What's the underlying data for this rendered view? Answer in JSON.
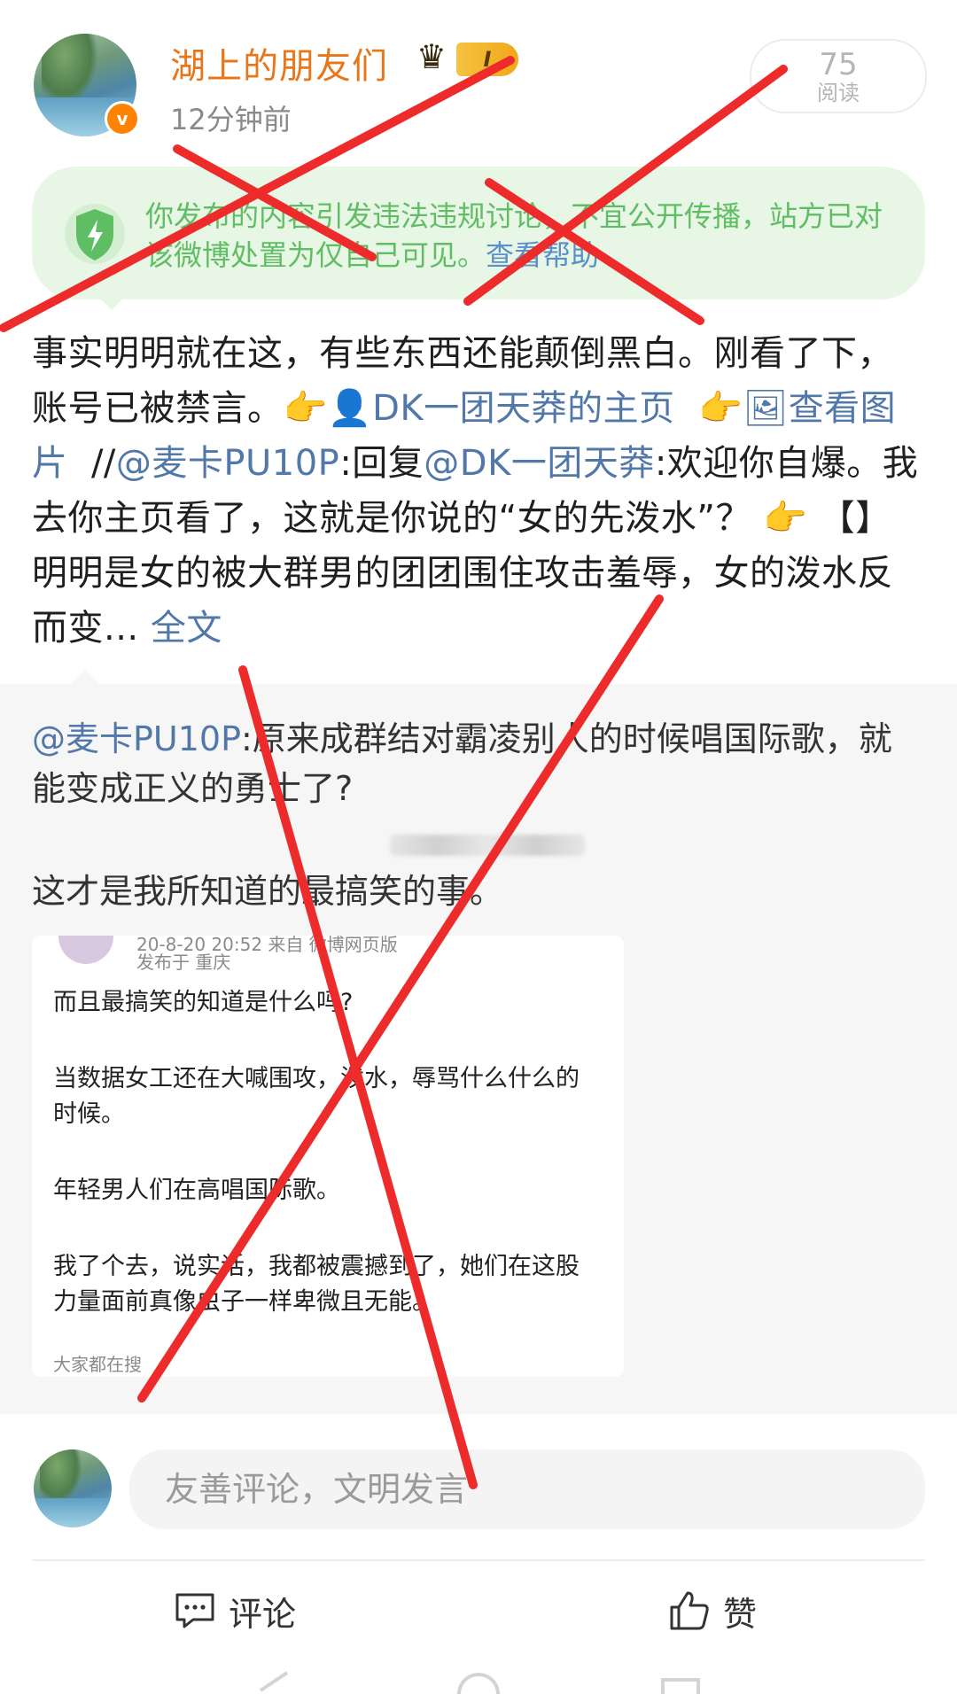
{
  "header": {
    "username": "湖上的朋友们",
    "level_badge": "I",
    "timestamp": "12分钟前",
    "read_count": "75",
    "read_label": "阅读"
  },
  "notice": {
    "text": "你发布的内容引发违法违规讨论，不宜公开传播，站方已对该微博处置为仅自己可见。",
    "help_link": "查看帮助"
  },
  "post": {
    "seg1": "事实明明就在这，有些东西还能颠倒黑白。刚看了下，账号已被禁言。",
    "emoji1": "👉",
    "profile_link": "DK一团天莽的主页",
    "emoji2": "👉",
    "image_link": "查看图片",
    "seg2": "//",
    "mention1": "@麦卡PU10P",
    "seg3": ":回复",
    "mention2": "@DK一团天莽",
    "seg4": ":欢迎你自爆。我去你主页看了，这就是你说的“女的先泼水”？",
    "emoji3": "👉",
    "seg5": "【】明明是女的被大群男的团团围住攻击羞辱，女的泼水反而变...",
    "full_text_link": "全文"
  },
  "repost": {
    "mention": "@麦卡PU10P",
    "text1": ":原来成群结对霸凌别人的时候唱国际歌，就能变成正义的勇士了?",
    "text2": "这才是我所知道的最搞笑的事。",
    "card": {
      "meta_top": "20-8-20 20:52 来自 微博网页版",
      "location": "发布于 重庆",
      "p1": "而且最搞笑的知道是什么吗?",
      "p2": "当数据女工还在大喊围攻，泼水，辱骂什么什么的时候。",
      "p3": "年轻男人们在高唱国际歌。",
      "p4": "我了个去，说实话，我都被震撼到了，她们在这股力量面前真像虫子一样卑微且无能。",
      "footer": "大家都在搜"
    }
  },
  "comment_bar": {
    "placeholder": "友善评论，文明发言"
  },
  "actions": {
    "comment_label": "评论",
    "like_label": "赞"
  },
  "colors": {
    "username": "#e8771b",
    "link": "#5178a8",
    "notice_text": "#5fbe63",
    "notice_bg": "#e8f6e6",
    "cross_lines": "#ee2b2b"
  }
}
